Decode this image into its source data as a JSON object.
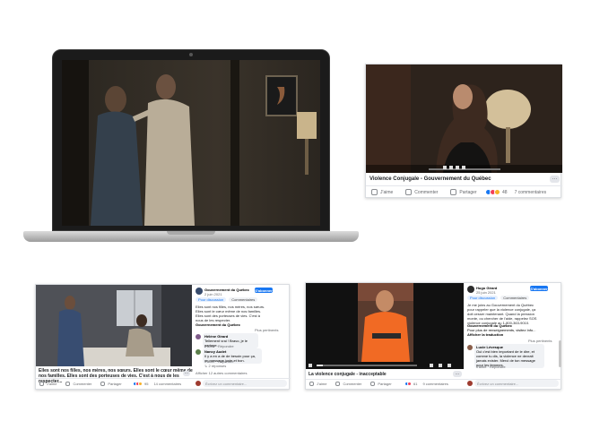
{
  "post_title": "Violence Conjugale - Gouvernement du Québec",
  "actions": {
    "like": "J'aime",
    "comment": "Commenter",
    "share": "Partager"
  },
  "top_right": {
    "reaction_count": "48",
    "comment_count": "7 commentaires",
    "more": "···"
  },
  "bottom_left": {
    "caption": "Elles sont nos filles, nos mères, nos sœurs. Elles sont le cœur même de nos familles. Elles sont des porteuses de vies. C'est à nous de les respecter...",
    "page_name": "Gouvernement du Québec",
    "date": "2 juin 2021",
    "tab_discussion": "Pour discussion",
    "tab_comments": "Commentaires",
    "subscribe": "S'abonner",
    "body_text": "Elles sont nos filles, nos mères, nos sœurs. Elles sont le cœur même de nos familles. Elles sont des porteuses de vies. C'est à nous de les respecter.",
    "body_bold": "Gouvernement du Québec",
    "filter": "Plus pertinents",
    "comment1_name": "Hélène Girard",
    "comment1_text": "Tellement vrai ! Bravo, je le partage.",
    "comment1_actions": "J'aime · Répondre",
    "comment2_name": "Nancy Audet",
    "comment2_text": "Il y a en a de de besoin pour ça, un message juste et bon.",
    "comment2_actions": "J'aime · Répondre",
    "replies": "↳ 2 réponses",
    "show_more": "Afficher 12 autres commentaires",
    "reaction_count": "95",
    "comment_count": "14 commentaires",
    "write_comment": "Écrivez un commentaire...",
    "more": "···"
  },
  "bottom_right": {
    "caption": "La violence conjugale - inacceptable",
    "page_name": "Hugo Girard",
    "date": "25 juin 2021",
    "tab_discussion": "Pour discussion",
    "tab_comments": "Commentaires",
    "subscribe": "S'abonner",
    "body_text": "Je me joins au Gouvernement du Québec pour rappeler que la violence conjugale, ça doit cesser maintenant. Quand la pression monte, ou chercher de l'aide, rappelez SOS violence conjugale au 1-800-363-9010.",
    "body_bold": "Gouvernement du Québec",
    "body_extra": "Pour plus de renseignements, visitez Info...",
    "show_translation": "Afficher la traduction",
    "filter": "Plus pertinents",
    "comment1_name": "Lucie Lévesque",
    "comment1_text": "Oui c'est bien important de le dire, et comme tu dis, la violence ne devrait jamais exister. Merci de ton message pour les femmes.",
    "comment1_actions": "J'aime · Répondre",
    "reaction_count": "61",
    "comment_count": "9 commentaires",
    "write_comment": "Écrivez un commentaire...",
    "more": "···"
  },
  "colors": {
    "facebook_blue": "#1877f2",
    "like": "#1877f2",
    "love": "#f33e58",
    "haha": "#f7b125"
  }
}
